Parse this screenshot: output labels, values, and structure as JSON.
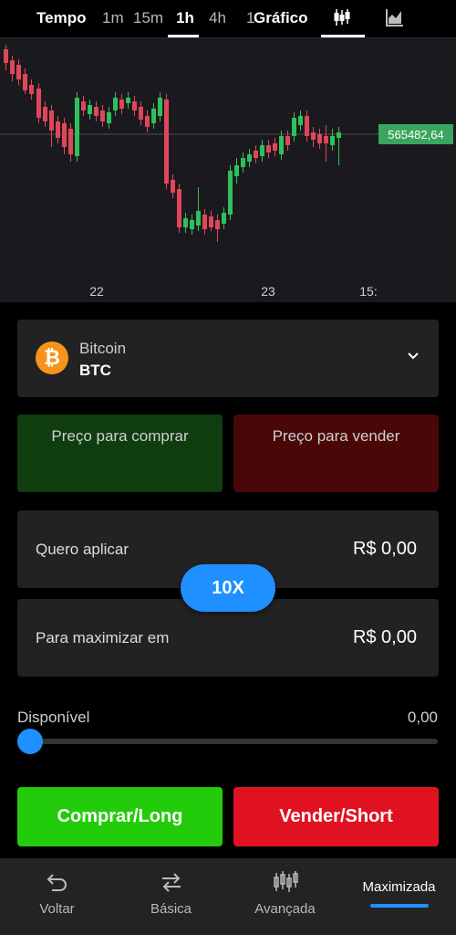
{
  "toolbar": {
    "time_label": "Tempo",
    "intervals": [
      "1m",
      "15m",
      "1h",
      "4h",
      "1"
    ],
    "selected_interval": "1h",
    "chart_label": "Gráfico",
    "icons": [
      "candlestick-icon",
      "area-chart-icon"
    ]
  },
  "chart": {
    "current_price": "565482,64",
    "x_labels": [
      "22",
      "23",
      "15:"
    ],
    "colors": {
      "up": "#2fbf5b",
      "down": "#e0465a",
      "background": "#1a1a1e",
      "price_tag": "#3aa55f"
    }
  },
  "asset": {
    "name": "Bitcoin",
    "symbol": "BTC",
    "logo_letter": "₿"
  },
  "prices": {
    "buy_label": "Preço para comprar",
    "sell_label": "Preço para vender"
  },
  "apply": {
    "label": "Quero aplicar",
    "value": "R$ 0,00"
  },
  "leverage": {
    "label": "10X"
  },
  "maximize": {
    "label": "Para maximizar em",
    "value": "R$ 0,00"
  },
  "available": {
    "label": "Disponível",
    "value": "0,00",
    "slider_fraction": 0
  },
  "actions": {
    "buy_label": "Comprar/Long",
    "sell_label": "Vender/Short"
  },
  "nav": {
    "items": [
      {
        "label": "Voltar",
        "icon": "undo-arrow-icon"
      },
      {
        "label": "Básica",
        "icon": "swap-arrows-icon"
      },
      {
        "label": "Avançada",
        "icon": "candles-icon"
      },
      {
        "label": "Maximizada",
        "icon": ""
      }
    ],
    "active": "Maximizada",
    "accent_color": "#1e90ff"
  }
}
